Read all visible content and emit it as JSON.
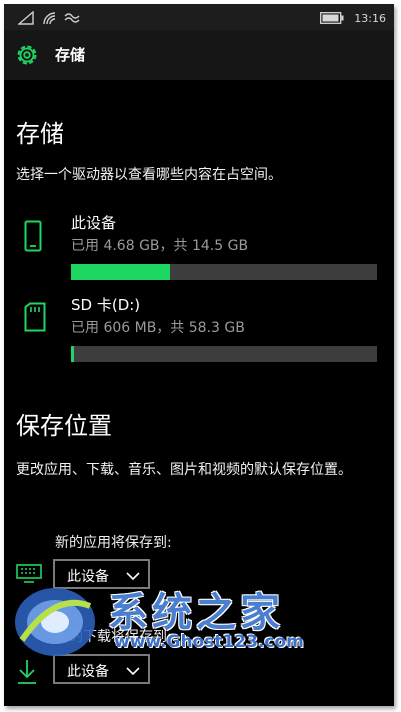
{
  "status_bar": {
    "time": "13:16"
  },
  "header": {
    "title": "存储"
  },
  "storage_section": {
    "heading": "存储",
    "description": "选择一个驱动器以查看哪些内容在占空间。",
    "drives": [
      {
        "name": "此设备",
        "usage": "已用 4.68 GB，共 14.5 GB",
        "used_fraction": 0.323,
        "icon": "phone-icon"
      },
      {
        "name": "SD 卡(D:)",
        "usage": "已用 606 MB，共 58.3 GB",
        "used_fraction": 0.01,
        "icon": "sd-card-icon"
      }
    ]
  },
  "save_section": {
    "heading": "保存位置",
    "description": "更改应用、下载、音乐、图片和视频的默认保存位置。",
    "apps": {
      "label": "新的应用将保存到:",
      "value": "此设备",
      "icon": "app-keyboard-icon"
    },
    "downloads": {
      "label": "新的下载将保存到:",
      "value": "此设备",
      "icon": "download-icon"
    }
  },
  "watermark": {
    "text": "系统之家",
    "url": "www.Ghost123.com"
  },
  "colors": {
    "accent": "#1ed760",
    "background": "#000000",
    "bar_track": "#3d3d3d",
    "secondary_text": "#9a9a9a"
  }
}
